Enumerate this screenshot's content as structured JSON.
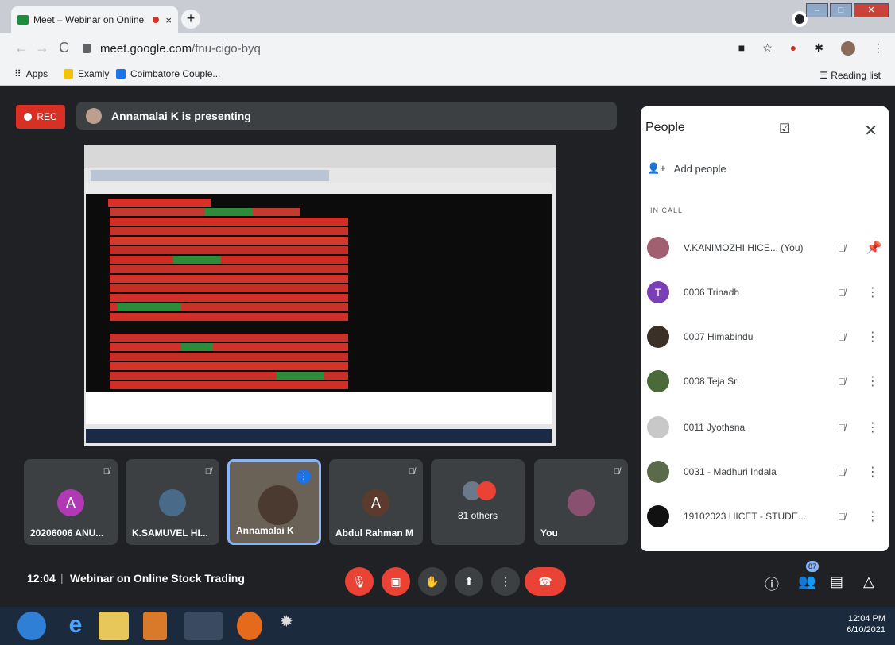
{
  "browser": {
    "tab_title": "Meet – Webinar on Online",
    "tab_close": "×",
    "new_tab": "+",
    "url_host": "meet.google.com",
    "url_path": "/fnu-cigo-byq",
    "bookmarks": [
      "Apps",
      "Examly",
      "Coimbatore Couple..."
    ],
    "reading_list": "Reading list"
  },
  "meet": {
    "rec_label": "REC",
    "presenting": "Annamalai K is presenting",
    "meeting_time": "12:04",
    "meeting_title": "Webinar on Online Stock Trading",
    "tiles": [
      {
        "name": "20206006 ANU...",
        "initial": "A",
        "color": "#b03ab5"
      },
      {
        "name": "K.SAMUVEL HI...",
        "initial": "",
        "color": "#4a6a8a"
      },
      {
        "name": "Annamalai K",
        "initial": "",
        "color": "#6a6256"
      },
      {
        "name": "Abdul Rahman M",
        "initial": "A",
        "color": "#5d3b2c"
      },
      {
        "name": "81 others",
        "initial": "",
        "color": "#3c4043"
      },
      {
        "name": "You",
        "initial": "",
        "color": "#8a5070"
      }
    ],
    "people_count": "87"
  },
  "panel": {
    "title": "People",
    "add_people": "Add people",
    "in_call": "IN CALL",
    "people": [
      {
        "name": "V.KANIMOZHI HICE...  (You)",
        "initial": "",
        "color": "#a06070"
      },
      {
        "name": "0006 Trinadh",
        "initial": "T",
        "color": "#7b3fb5"
      },
      {
        "name": "0007 Himabindu",
        "initial": "",
        "color": "#3a3028"
      },
      {
        "name": "0008 Teja Sri",
        "initial": "",
        "color": "#4a6a3a"
      },
      {
        "name": "0011 Jyothsna",
        "initial": "",
        "color": "#c8c8c8"
      },
      {
        "name": "0031 - Madhuri Indala",
        "initial": "",
        "color": "#5a6a4a"
      },
      {
        "name": "19102023 HICET - STUDE...",
        "initial": "",
        "color": "#111111"
      }
    ]
  },
  "taskbar": {
    "time": "12:04 PM",
    "date": "6/10/2021"
  }
}
